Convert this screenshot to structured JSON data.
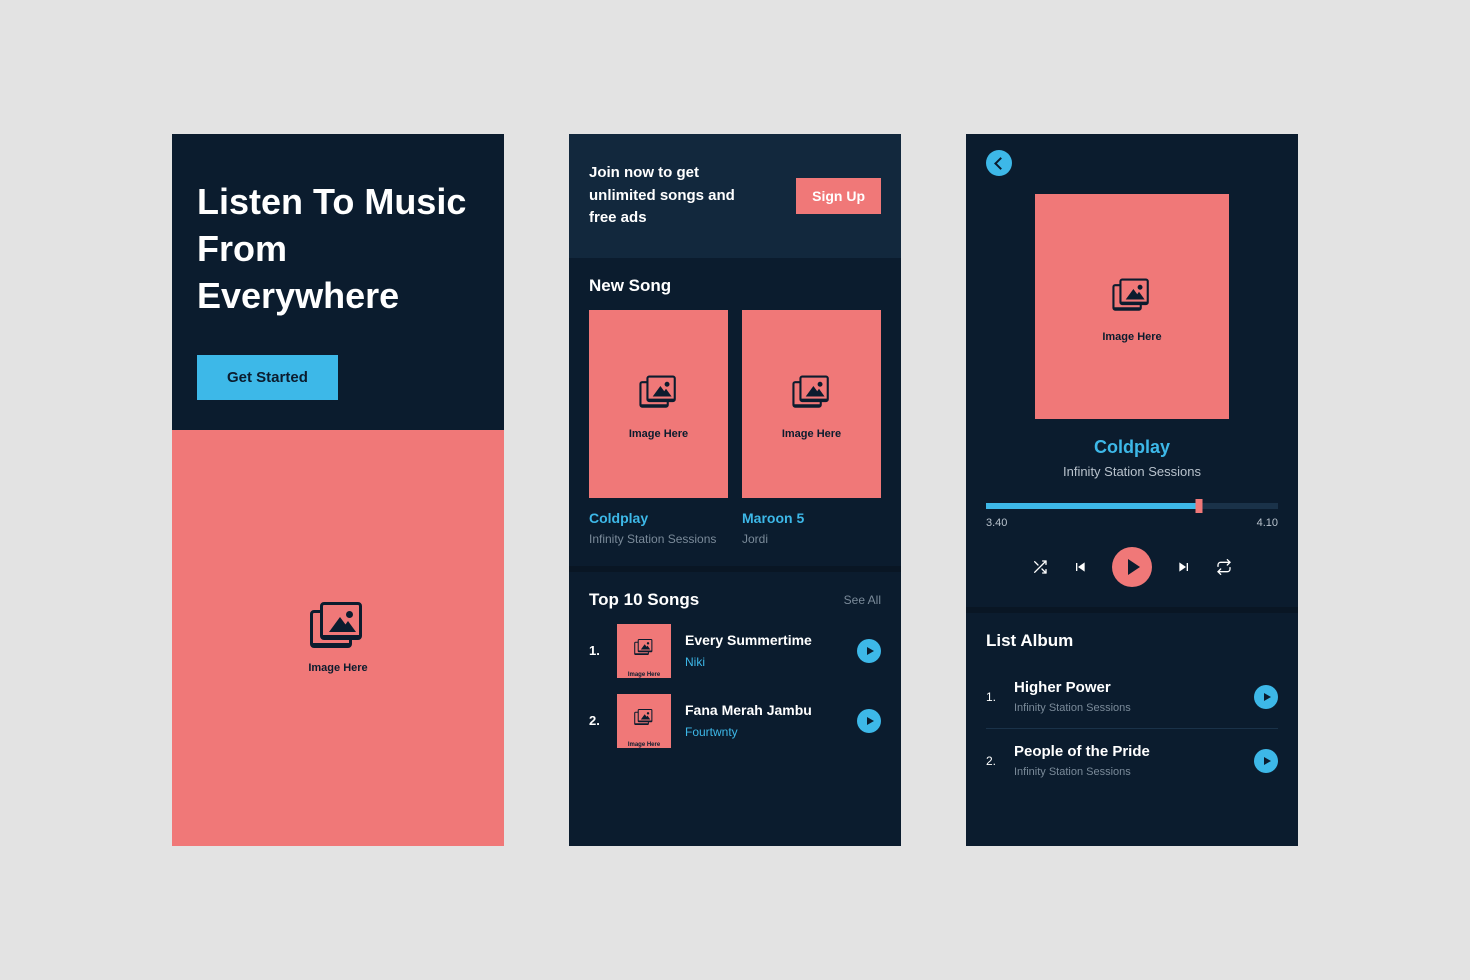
{
  "colors": {
    "bg": "#0b1c2e",
    "accent_blue": "#3db8e8",
    "accent_coral": "#f07878"
  },
  "placeholder_label": "Image Here",
  "screen1": {
    "title": "Listen To Music From Everywhere",
    "cta": "Get Started"
  },
  "screen2": {
    "banner_text": "Join now to get unlimited songs and free ads",
    "signup": "Sign Up",
    "new_song_title": "New Song",
    "new_songs": [
      {
        "artist": "Coldplay",
        "album": "Infinity Station Sessions"
      },
      {
        "artist": "Maroon 5",
        "album": "Jordi"
      }
    ],
    "top_title": "Top 10 Songs",
    "see_all": "See All",
    "top_songs": [
      {
        "n": "1.",
        "title": "Every Summertime",
        "artist": "Niki"
      },
      {
        "n": "2.",
        "title": "Fana Merah Jambu",
        "artist": "Fourtwnty"
      }
    ]
  },
  "screen3": {
    "artist": "Coldplay",
    "album": "Infinity Station Sessions",
    "time_current": "3.40",
    "time_total": "4.10",
    "progress_pct": 73,
    "list_title": "List Album",
    "tracks": [
      {
        "n": "1.",
        "title": "Higher Power",
        "sub": "Infinity Station Sessions"
      },
      {
        "n": "2.",
        "title": "People of the Pride",
        "sub": "Infinity Station Sessions"
      }
    ]
  }
}
